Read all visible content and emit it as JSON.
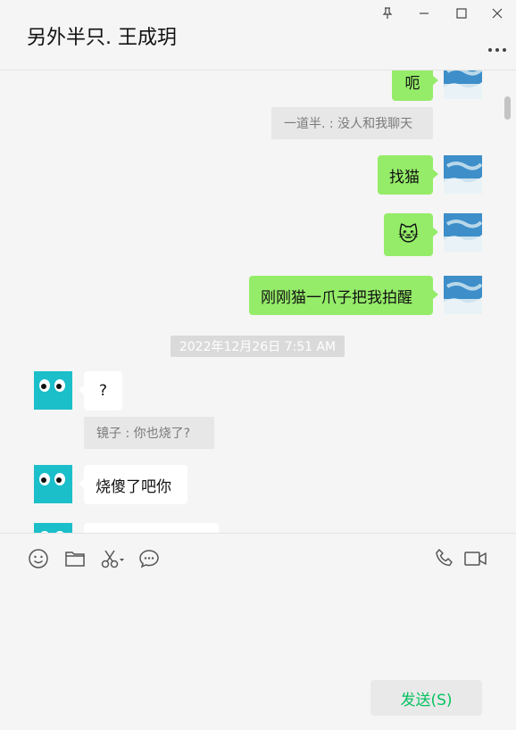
{
  "window": {
    "title": "另外半只. 王成玥"
  },
  "messages": [
    {
      "side": "right",
      "text": "呃"
    },
    {
      "quote": "一道半. : 没人和我聊天"
    },
    {
      "side": "right",
      "text": "找猫"
    },
    {
      "side": "right",
      "emoji": "🐱"
    },
    {
      "side": "right",
      "text": "刚刚猫一爪子把我拍醒"
    },
    {
      "timestamp": "2022年12月26日 7:51 AM"
    },
    {
      "side": "left",
      "text": "?"
    },
    {
      "quote": "镜子 : 你也烧了?"
    },
    {
      "side": "left",
      "text": "烧傻了吧你"
    }
  ],
  "toolbar": {
    "icons": [
      "emoji-icon",
      "folder-icon",
      "scissors-icon",
      "chat-history-icon",
      "phone-icon",
      "video-icon"
    ]
  },
  "send": {
    "label": "发送(S)"
  },
  "colors": {
    "my_bubble": "#95ec69",
    "their_bubble": "#ffffff",
    "accent": "#07c160",
    "avatar_teal": "#1bbfca"
  }
}
